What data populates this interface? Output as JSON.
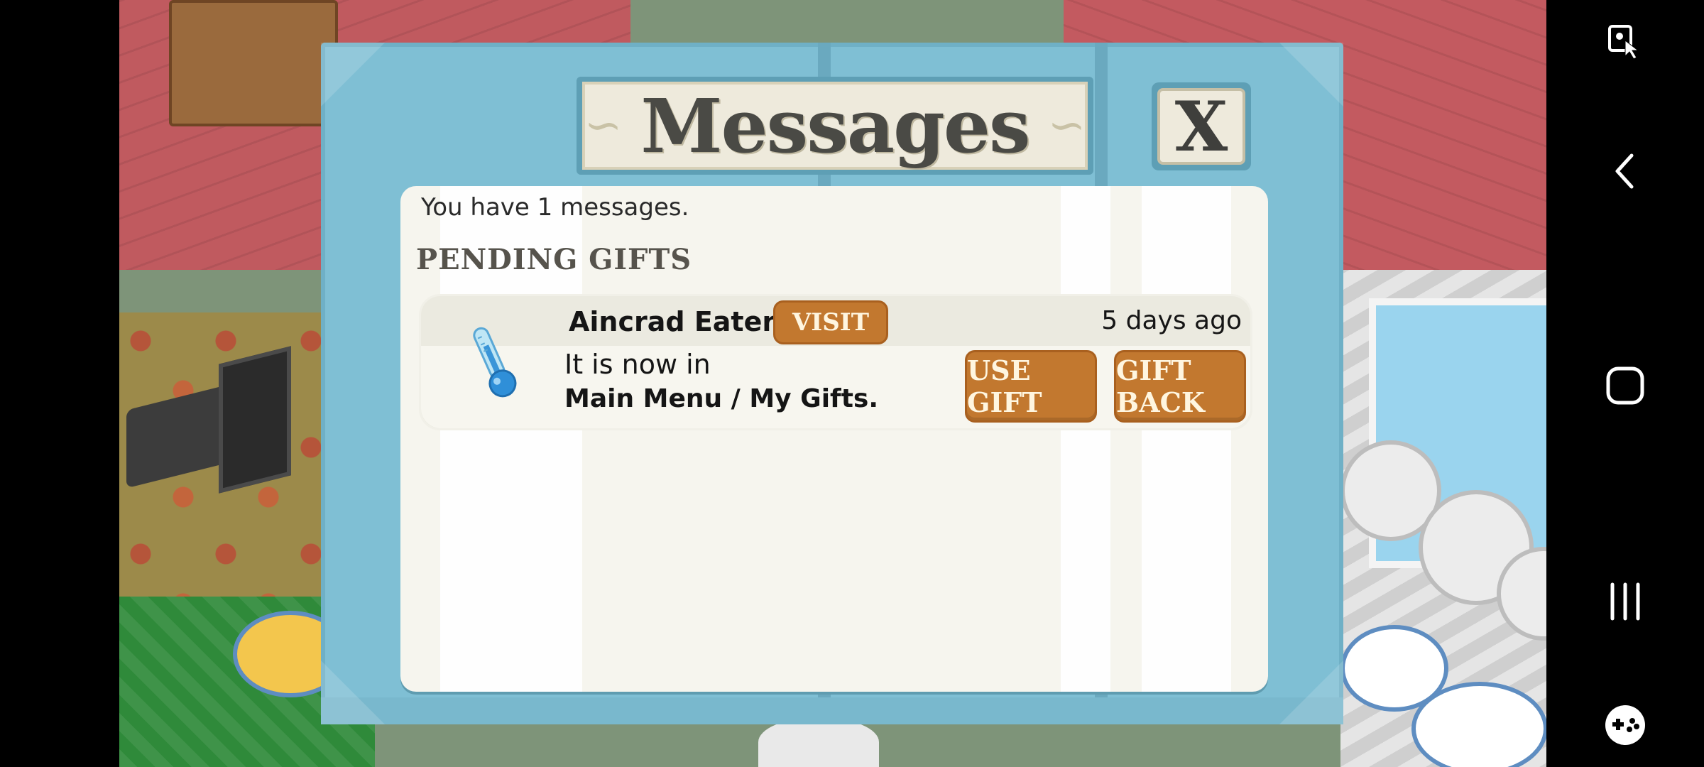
{
  "dialog": {
    "title": "Messages",
    "close_label": "X",
    "message_count_text": "You have 1 messages.",
    "section_title": "PENDING GIFTS"
  },
  "gifts": [
    {
      "sender": "Aincrad Eatery",
      "visit_label": "VISIT",
      "timestamp": "5 days ago",
      "message_line1": "It is now in",
      "message_line2": "Main Menu / My Gifts.",
      "use_label": "USE GIFT",
      "back_label": "GIFT BACK",
      "icon": "thermometer-icon"
    }
  ],
  "nav": {
    "icons": [
      "screen-capture-icon",
      "back-icon",
      "home-icon",
      "recents-icon",
      "game-launcher-icon"
    ]
  },
  "colors": {
    "frame": "#7fbfd4",
    "panel": "#f6f5ee",
    "button": "#c2782f",
    "button_text": "#fff6e0"
  }
}
